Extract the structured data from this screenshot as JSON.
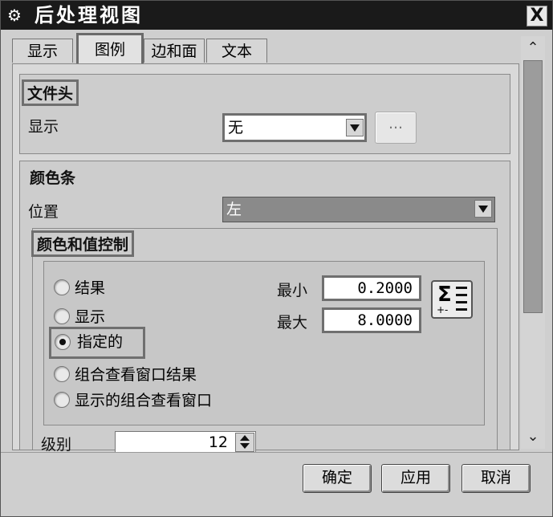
{
  "window": {
    "title": "后处理视图",
    "close_label": "X"
  },
  "tabs": [
    {
      "label": "显示",
      "active": false
    },
    {
      "label": "图例",
      "active": true
    },
    {
      "label": "边和面",
      "active": false
    },
    {
      "label": "文本",
      "active": false
    }
  ],
  "file_header": {
    "title": "文件头",
    "display_label": "显示",
    "display_value": "无",
    "ellipsis_label": "..."
  },
  "color_bar": {
    "title": "颜色条",
    "position_label": "位置",
    "position_value": "左"
  },
  "color_value_control": {
    "title": "颜色和值控制",
    "options": [
      {
        "label": "结果",
        "selected": false
      },
      {
        "label": "显示",
        "selected": false
      },
      {
        "label": "指定的",
        "selected": true
      },
      {
        "label": "组合查看窗口结果",
        "selected": false
      },
      {
        "label": "显示的组合查看窗口",
        "selected": false
      }
    ],
    "min_label": "最小",
    "min_value": "0.2000",
    "max_label": "最大",
    "max_value": "8.0000",
    "sigma_symbol": "Σ",
    "sigma_sub": "+-"
  },
  "level": {
    "label": "级别",
    "value": "12"
  },
  "buttons": {
    "ok": "确定",
    "apply": "应用",
    "cancel": "取消"
  },
  "icons": {
    "title": "gear-icon",
    "close": "close-icon",
    "dropdown": "chevron-down-icon",
    "scroll_up": "chevron-up-icon",
    "scroll_down": "chevron-down-icon",
    "spinner": "spinner-arrows-icon",
    "sum": "sigma-icon"
  }
}
